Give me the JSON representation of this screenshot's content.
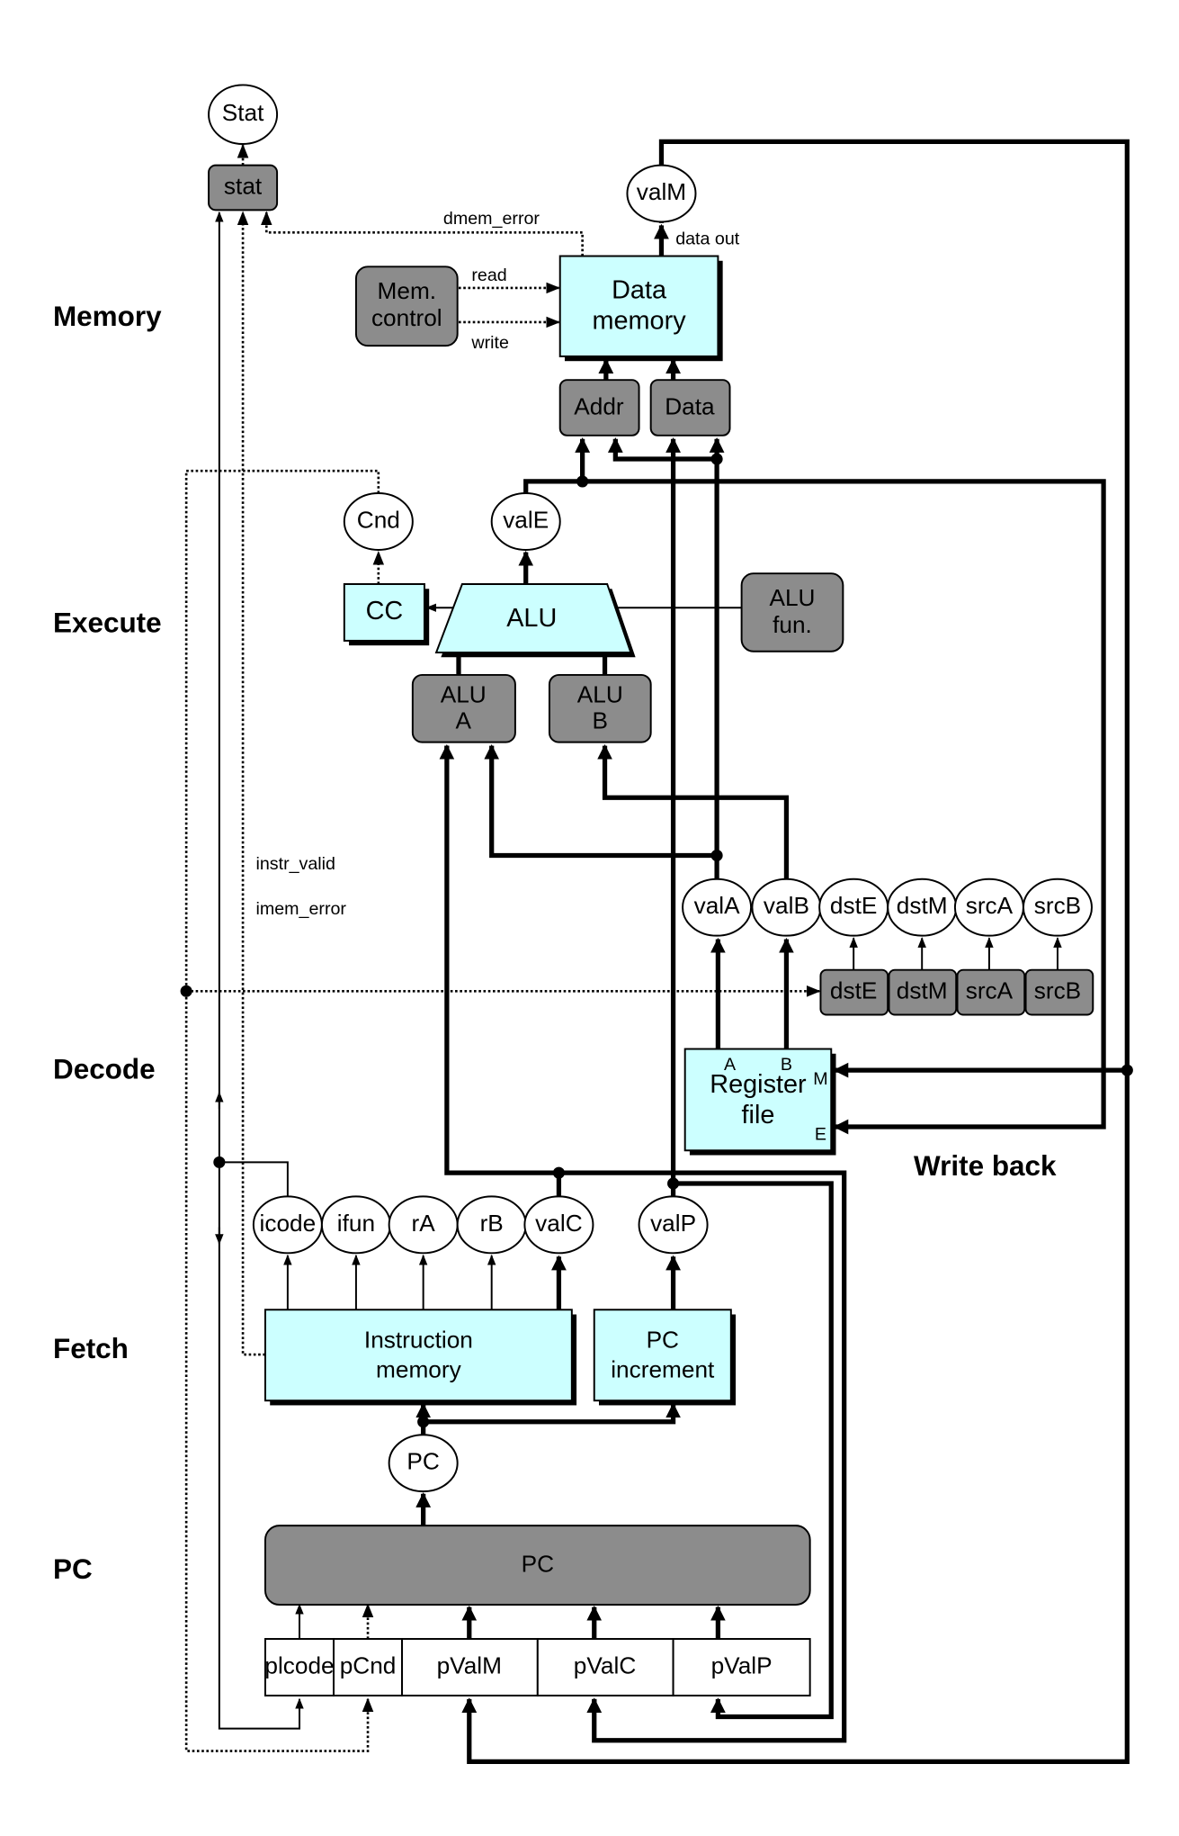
{
  "stages": {
    "memory": "Memory",
    "execute": "Execute",
    "decode": "Decode",
    "fetch": "Fetch",
    "pc": "PC",
    "write_back": "Write back"
  },
  "memory": {
    "stat_out": "Stat",
    "stat_reg": "stat",
    "valM": "valM",
    "data_out": "data out",
    "dmem_error": "dmem_error",
    "mem_control": [
      "Mem.",
      "control"
    ],
    "read": "read",
    "write": "write",
    "data_memory": [
      "Data",
      "memory"
    ],
    "addr": "Addr",
    "data": "Data"
  },
  "execute": {
    "cnd": "Cnd",
    "valE": "valE",
    "cc": "CC",
    "alu": "ALU",
    "alu_fun": [
      "ALU",
      "fun."
    ],
    "alu_a": [
      "ALU",
      "A"
    ],
    "alu_b": [
      "ALU",
      "B"
    ]
  },
  "decode": {
    "signals": [
      "valA",
      "valB",
      "dstE",
      "dstM",
      "srcA",
      "srcB"
    ],
    "regs": [
      "dstE",
      "dstM",
      "srcA",
      "srcB"
    ],
    "register_file": [
      "Register",
      "file"
    ],
    "ports": {
      "a": "A",
      "b": "B",
      "m": "M",
      "e": "E"
    },
    "instr_valid": "instr_valid",
    "imem_error": "imem_error"
  },
  "fetch": {
    "signals": [
      "icode",
      "ifun",
      "rA",
      "rB",
      "valC",
      "valP"
    ],
    "instruction_memory": [
      "Instruction",
      "memory"
    ],
    "pc_increment": [
      "PC",
      "increment"
    ],
    "pc": "PC"
  },
  "pc_stage": {
    "pc_box": "PC",
    "fields": [
      "plcode",
      "pCnd",
      "pValM",
      "pValC",
      "pValP"
    ]
  },
  "colors": {
    "logic": "#ccffff",
    "register": "#8c8c8c"
  }
}
